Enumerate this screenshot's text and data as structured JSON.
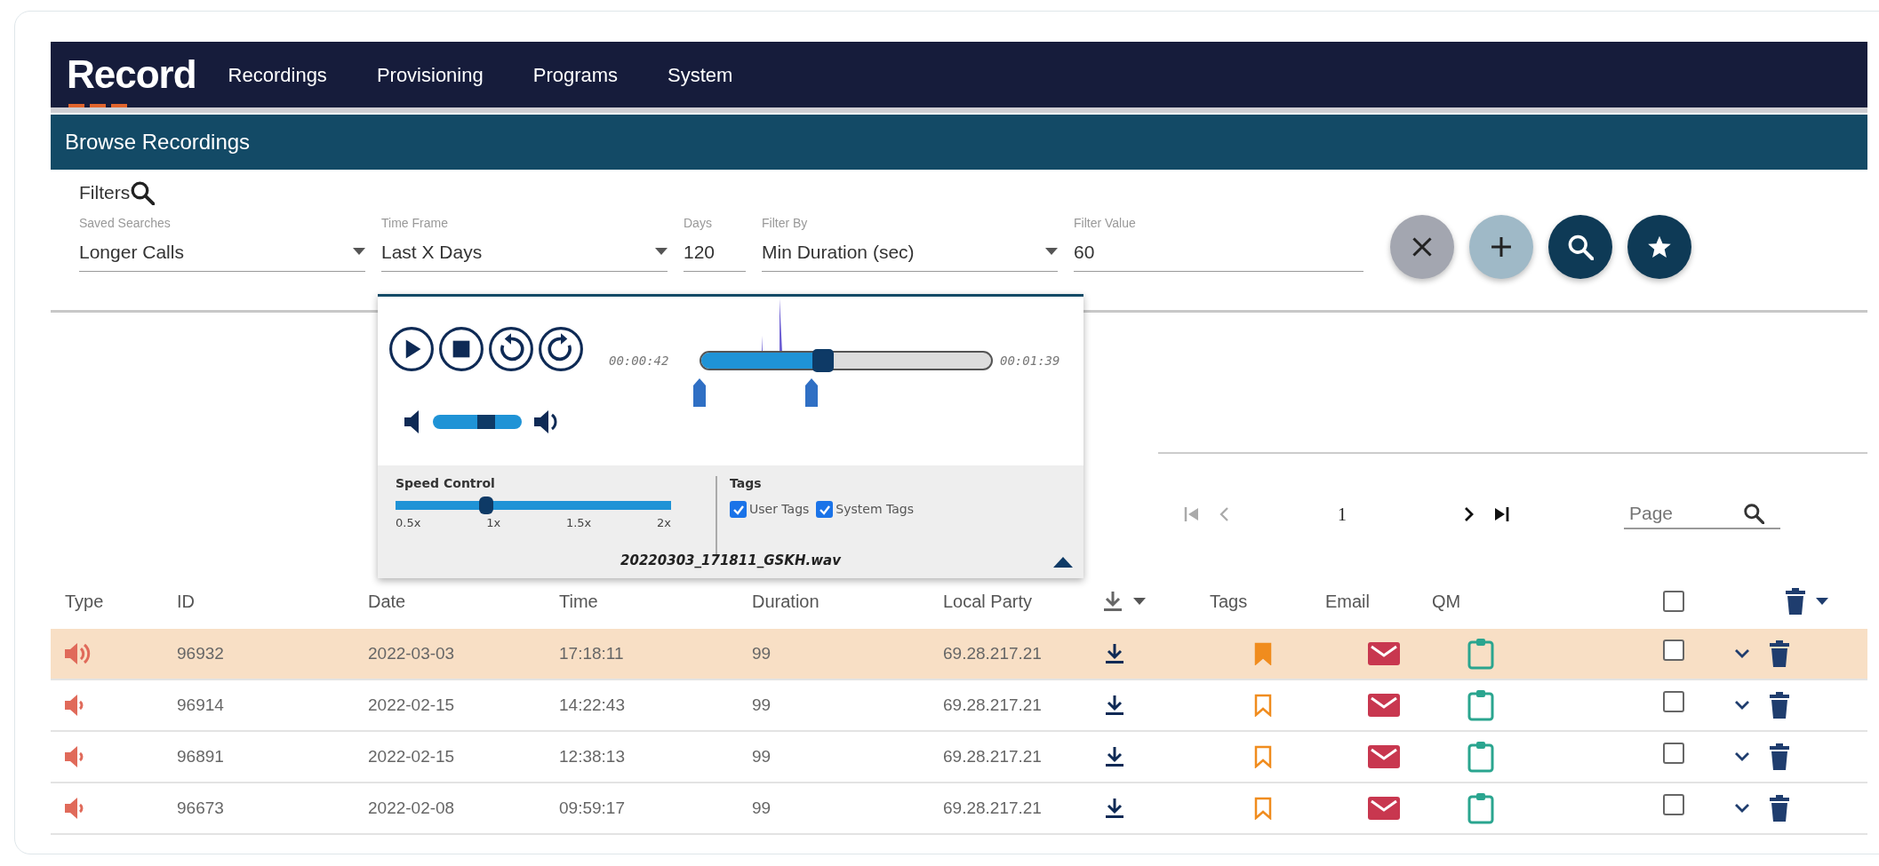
{
  "app": {
    "logo": "Record"
  },
  "nav": [
    {
      "label": "Recordings"
    },
    {
      "label": "Provisioning"
    },
    {
      "label": "Programs"
    },
    {
      "label": "System"
    }
  ],
  "page_title": "Browse Recordings",
  "filters": {
    "title": "Filters",
    "fields": [
      {
        "kind": "select",
        "label": "Saved Searches",
        "value": "Longer Calls"
      },
      {
        "kind": "select",
        "label": "Time Frame",
        "value": "Last X Days"
      },
      {
        "kind": "input",
        "label": "Days",
        "value": "120"
      },
      {
        "kind": "select",
        "label": "Filter By",
        "value": "Min Duration (sec)"
      },
      {
        "kind": "input",
        "label": "Filter Value",
        "value": "60"
      }
    ],
    "actions": [
      {
        "kind": "clear"
      },
      {
        "kind": "add"
      },
      {
        "kind": "search"
      },
      {
        "kind": "favorite"
      }
    ]
  },
  "player": {
    "elapsed": "00:00:42",
    "total": "00:01:39",
    "position": {
      "level": 0.42
    },
    "volume": {
      "level": 0.6
    },
    "speed": {
      "title": "Speed Control",
      "level": 0.33,
      "ticks": [
        "0.5x",
        "1x",
        "1.5x",
        "2x"
      ]
    },
    "tags": {
      "title": "Tags",
      "options": [
        {
          "label": "User Tags",
          "checked": true
        },
        {
          "label": "System Tags",
          "checked": true
        }
      ]
    },
    "file_name": "20220303_171811_GSKH.wav"
  },
  "pagination": {
    "buttons": [
      {
        "kind": "first",
        "disabled": true
      },
      {
        "kind": "prev",
        "disabled": true
      },
      {
        "kind": "next",
        "disabled": false
      },
      {
        "kind": "last",
        "disabled": false
      }
    ],
    "page": "1",
    "page_field": {
      "placeholder": "Page"
    }
  },
  "table": {
    "columns": [
      {
        "kind": "text",
        "label": "Type"
      },
      {
        "kind": "text",
        "label": "ID"
      },
      {
        "kind": "text",
        "label": "Date"
      },
      {
        "kind": "text",
        "label": "Time"
      },
      {
        "kind": "text",
        "label": "Duration"
      },
      {
        "kind": "text",
        "label": "Local Party"
      },
      {
        "kind": "download"
      },
      {
        "kind": "text",
        "label": "Tags"
      },
      {
        "kind": "text",
        "label": "Email"
      },
      {
        "kind": "text",
        "label": "QM"
      },
      {
        "kind": "select_all",
        "checked": false
      },
      {
        "kind": "delete"
      }
    ],
    "rows": [
      {
        "selected": true,
        "playing": true,
        "id": "96932",
        "date": "2022-03-03",
        "time": "17:18:11",
        "duration": "99",
        "local_party": "69.28.217.21",
        "tagged": true,
        "checked": false
      },
      {
        "selected": false,
        "playing": false,
        "id": "96914",
        "date": "2022-02-15",
        "time": "14:22:43",
        "duration": "99",
        "local_party": "69.28.217.21",
        "tagged": false,
        "checked": false
      },
      {
        "selected": false,
        "playing": false,
        "id": "96891",
        "date": "2022-02-15",
        "time": "12:38:13",
        "duration": "99",
        "local_party": "69.28.217.21",
        "tagged": false,
        "checked": false
      },
      {
        "selected": false,
        "playing": false,
        "id": "96673",
        "date": "2022-02-08",
        "time": "09:59:17",
        "duration": "99",
        "local_party": "69.28.217.21",
        "tagged": false,
        "checked": false
      }
    ]
  }
}
